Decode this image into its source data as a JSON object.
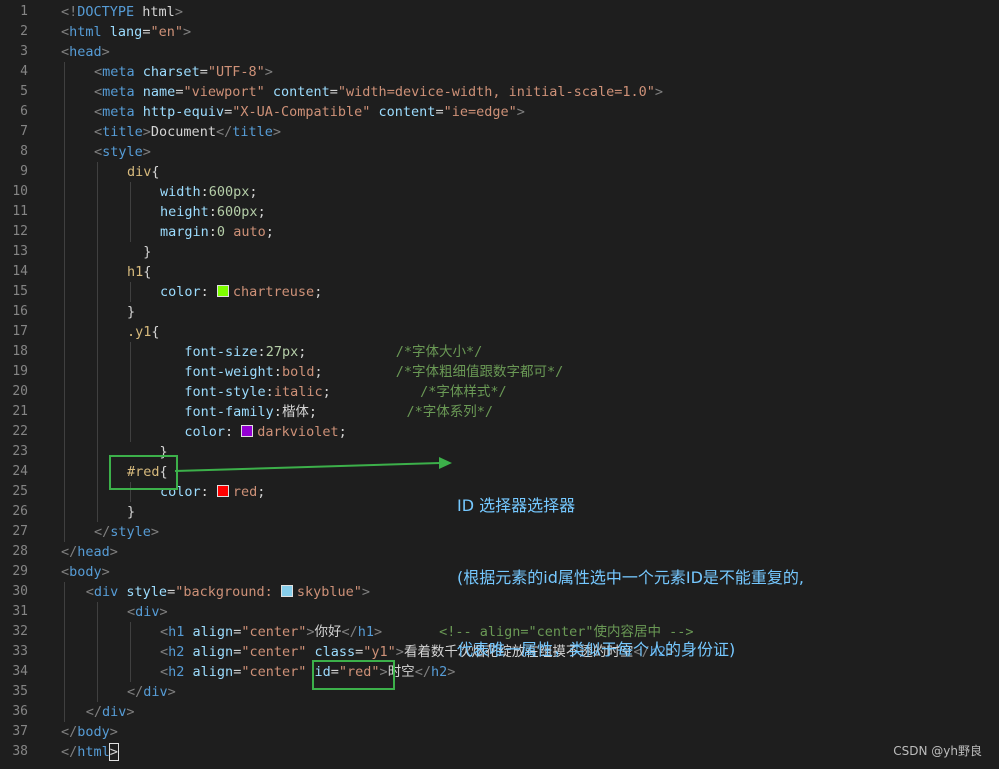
{
  "editor": {
    "lines": [
      {
        "n": "1",
        "i": 0,
        "guides": [],
        "t": [
          [
            "punct",
            "<!"
          ],
          [
            "tag",
            "DOCTYPE"
          ],
          [
            "text",
            " html"
          ],
          [
            "punct",
            ">"
          ]
        ]
      },
      {
        "n": "2",
        "i": 0,
        "guides": [],
        "t": [
          [
            "punct",
            "<"
          ],
          [
            "tag",
            "html"
          ],
          [
            "text",
            " "
          ],
          [
            "attr",
            "lang"
          ],
          [
            "text",
            "="
          ],
          [
            "str",
            "\"en\""
          ],
          [
            "punct",
            ">"
          ]
        ]
      },
      {
        "n": "3",
        "i": 0,
        "guides": [],
        "t": [
          [
            "punct",
            "<"
          ],
          [
            "tag",
            "head"
          ],
          [
            "punct",
            ">"
          ]
        ]
      },
      {
        "n": "4",
        "i": 1,
        "guides": [
          0
        ],
        "t": [
          [
            "punct",
            "<"
          ],
          [
            "tag",
            "meta"
          ],
          [
            "text",
            " "
          ],
          [
            "attr",
            "charset"
          ],
          [
            "text",
            "="
          ],
          [
            "str",
            "\"UTF-8\""
          ],
          [
            "punct",
            ">"
          ]
        ]
      },
      {
        "n": "5",
        "i": 1,
        "guides": [
          0
        ],
        "t": [
          [
            "punct",
            "<"
          ],
          [
            "tag",
            "meta"
          ],
          [
            "text",
            " "
          ],
          [
            "attr",
            "name"
          ],
          [
            "text",
            "="
          ],
          [
            "str",
            "\"viewport\""
          ],
          [
            "text",
            " "
          ],
          [
            "attr",
            "content"
          ],
          [
            "text",
            "="
          ],
          [
            "str",
            "\"width=device-width, initial-scale=1.0\""
          ],
          [
            "punct",
            ">"
          ]
        ]
      },
      {
        "n": "6",
        "i": 1,
        "guides": [
          0
        ],
        "t": [
          [
            "punct",
            "<"
          ],
          [
            "tag",
            "meta"
          ],
          [
            "text",
            " "
          ],
          [
            "attr",
            "http-equiv"
          ],
          [
            "text",
            "="
          ],
          [
            "str",
            "\"X-UA-Compatible\""
          ],
          [
            "text",
            " "
          ],
          [
            "attr",
            "content"
          ],
          [
            "text",
            "="
          ],
          [
            "str",
            "\"ie=edge\""
          ],
          [
            "punct",
            ">"
          ]
        ]
      },
      {
        "n": "7",
        "i": 1,
        "guides": [
          0
        ],
        "t": [
          [
            "punct",
            "<"
          ],
          [
            "tag",
            "title"
          ],
          [
            "punct",
            ">"
          ],
          [
            "text",
            "Document"
          ],
          [
            "punct",
            "</"
          ],
          [
            "tag",
            "title"
          ],
          [
            "punct",
            ">"
          ]
        ]
      },
      {
        "n": "8",
        "i": 1,
        "guides": [
          0
        ],
        "t": [
          [
            "punct",
            "<"
          ],
          [
            "tag",
            "style"
          ],
          [
            "punct",
            ">"
          ]
        ]
      },
      {
        "n": "9",
        "i": 2,
        "guides": [
          0,
          1
        ],
        "t": [
          [
            "sel",
            "div"
          ],
          [
            "text",
            "{"
          ]
        ]
      },
      {
        "n": "10",
        "i": 3,
        "guides": [
          0,
          1,
          2
        ],
        "t": [
          [
            "prop",
            "width"
          ],
          [
            "text",
            ":"
          ],
          [
            "num",
            "600px"
          ],
          [
            "text",
            ";"
          ]
        ]
      },
      {
        "n": "11",
        "i": 3,
        "guides": [
          0,
          1,
          2
        ],
        "t": [
          [
            "prop",
            "height"
          ],
          [
            "text",
            ":"
          ],
          [
            "num",
            "600px"
          ],
          [
            "text",
            ";"
          ]
        ]
      },
      {
        "n": "12",
        "i": 3,
        "guides": [
          0,
          1,
          2
        ],
        "t": [
          [
            "prop",
            "margin"
          ],
          [
            "text",
            ":"
          ],
          [
            "num",
            "0"
          ],
          [
            "text",
            " "
          ],
          [
            "str",
            "auto"
          ],
          [
            "text",
            ";"
          ]
        ]
      },
      {
        "n": "13",
        "i": 2,
        "guides": [
          0,
          1
        ],
        "t": [
          [
            "text",
            "  }"
          ]
        ]
      },
      {
        "n": "14",
        "i": 2,
        "guides": [
          0,
          1
        ],
        "t": [
          [
            "sel",
            "h1"
          ],
          [
            "text",
            "{"
          ]
        ]
      },
      {
        "n": "15",
        "i": 3,
        "guides": [
          0,
          1,
          2
        ],
        "t": [
          [
            "prop",
            "color"
          ],
          [
            "text",
            ": "
          ],
          [
            "swatch",
            "#7fff00"
          ],
          [
            "str",
            "chartreuse"
          ],
          [
            "text",
            ";"
          ]
        ]
      },
      {
        "n": "16",
        "i": 2,
        "guides": [
          0,
          1
        ],
        "t": [
          [
            "text",
            "}"
          ]
        ]
      },
      {
        "n": "17",
        "i": 2,
        "guides": [
          0,
          1
        ],
        "t": [
          [
            "sel",
            ".y1"
          ],
          [
            "text",
            "{"
          ]
        ]
      },
      {
        "n": "18",
        "i": 3,
        "guides": [
          0,
          1,
          2
        ],
        "t": [
          [
            "text",
            "   "
          ],
          [
            "prop",
            "font-size"
          ],
          [
            "text",
            ":"
          ],
          [
            "num",
            "27px"
          ],
          [
            "text",
            ";           "
          ],
          [
            "comment",
            "/*字体大小*/"
          ]
        ]
      },
      {
        "n": "19",
        "i": 3,
        "guides": [
          0,
          1,
          2
        ],
        "t": [
          [
            "text",
            "   "
          ],
          [
            "prop",
            "font-weight"
          ],
          [
            "text",
            ":"
          ],
          [
            "str",
            "bold"
          ],
          [
            "text",
            ";         "
          ],
          [
            "comment",
            "/*字体粗细值跟数字都可*/"
          ]
        ]
      },
      {
        "n": "20",
        "i": 3,
        "guides": [
          0,
          1,
          2
        ],
        "t": [
          [
            "text",
            "   "
          ],
          [
            "prop",
            "font-style"
          ],
          [
            "text",
            ":"
          ],
          [
            "str",
            "italic"
          ],
          [
            "text",
            ";           "
          ],
          [
            "comment",
            "/*字体样式*/"
          ]
        ]
      },
      {
        "n": "21",
        "i": 3,
        "guides": [
          0,
          1,
          2
        ],
        "t": [
          [
            "text",
            "   "
          ],
          [
            "prop",
            "font-family"
          ],
          [
            "text",
            ":"
          ],
          [
            "text",
            "楷体;"
          ],
          [
            "text",
            "           "
          ],
          [
            "comment",
            "/*字体系列*/"
          ]
        ]
      },
      {
        "n": "22",
        "i": 3,
        "guides": [
          0,
          1,
          2
        ],
        "t": [
          [
            "text",
            "   "
          ],
          [
            "prop",
            "color"
          ],
          [
            "text",
            ": "
          ],
          [
            "swatch",
            "#9400d3"
          ],
          [
            "str",
            "darkviolet"
          ],
          [
            "text",
            ";"
          ]
        ]
      },
      {
        "n": "23",
        "i": 2,
        "guides": [
          0,
          1
        ],
        "t": [
          [
            "text",
            "    }"
          ]
        ]
      },
      {
        "n": "24",
        "i": 2,
        "guides": [
          0,
          1
        ],
        "t": [
          [
            "sel",
            "#red"
          ],
          [
            "text",
            "{"
          ]
        ]
      },
      {
        "n": "25",
        "i": 3,
        "guides": [
          0,
          1,
          2
        ],
        "t": [
          [
            "prop",
            "color"
          ],
          [
            "text",
            ": "
          ],
          [
            "swatch",
            "#ff0000"
          ],
          [
            "str",
            "red"
          ],
          [
            "text",
            ";"
          ]
        ]
      },
      {
        "n": "26",
        "i": 2,
        "guides": [
          0,
          1
        ],
        "t": [
          [
            "text",
            "}"
          ]
        ]
      },
      {
        "n": "27",
        "i": 1,
        "guides": [
          0
        ],
        "t": [
          [
            "punct",
            "</"
          ],
          [
            "tag",
            "style"
          ],
          [
            "punct",
            ">"
          ]
        ]
      },
      {
        "n": "28",
        "i": 0,
        "guides": [],
        "t": [
          [
            "punct",
            "</"
          ],
          [
            "tag",
            "head"
          ],
          [
            "punct",
            ">"
          ]
        ]
      },
      {
        "n": "29",
        "i": 0,
        "guides": [],
        "t": [
          [
            "punct",
            "<"
          ],
          [
            "tag",
            "body"
          ],
          [
            "punct",
            ">"
          ]
        ]
      },
      {
        "n": "30",
        "i": 0.75,
        "guides": [
          0
        ],
        "t": [
          [
            "punct",
            "<"
          ],
          [
            "tag",
            "div"
          ],
          [
            "text",
            " "
          ],
          [
            "attr",
            "style"
          ],
          [
            "text",
            "="
          ],
          [
            "str",
            "\"background: "
          ],
          [
            "swatch",
            "#87ceeb"
          ],
          [
            "str",
            "skyblue\""
          ],
          [
            "punct",
            ">"
          ]
        ]
      },
      {
        "n": "31",
        "i": 2,
        "guides": [
          0,
          1
        ],
        "t": [
          [
            "punct",
            "<"
          ],
          [
            "tag",
            "div"
          ],
          [
            "punct",
            ">"
          ]
        ]
      },
      {
        "n": "32",
        "i": 3,
        "guides": [
          0,
          1,
          2
        ],
        "t": [
          [
            "punct",
            "<"
          ],
          [
            "tag",
            "h1"
          ],
          [
            "text",
            " "
          ],
          [
            "attr",
            "align"
          ],
          [
            "text",
            "="
          ],
          [
            "str",
            "\"center\""
          ],
          [
            "punct",
            ">"
          ],
          [
            "text",
            "你好"
          ],
          [
            "punct",
            "</"
          ],
          [
            "tag",
            "h1"
          ],
          [
            "punct",
            ">"
          ],
          [
            "text",
            "       "
          ],
          [
            "comment",
            "<!-- align=\"center\"使内容居中 -->"
          ]
        ]
      },
      {
        "n": "33",
        "i": 3,
        "guides": [
          0,
          1,
          2
        ],
        "t": [
          [
            "punct",
            "<"
          ],
          [
            "tag",
            "h2"
          ],
          [
            "text",
            " "
          ],
          [
            "attr",
            "align"
          ],
          [
            "text",
            "="
          ],
          [
            "str",
            "\"center\""
          ],
          [
            "text",
            " "
          ],
          [
            "attr",
            "class"
          ],
          [
            "text",
            "="
          ],
          [
            "str",
            "\"y1\""
          ],
          [
            "punct",
            ">"
          ],
          [
            "text",
            "看着数千次烟花绽放在组摸不透的时空"
          ],
          [
            "punct",
            "</"
          ],
          [
            "tag",
            "h2"
          ],
          [
            "punct",
            ">"
          ]
        ]
      },
      {
        "n": "34",
        "i": 3,
        "guides": [
          0,
          1,
          2
        ],
        "t": [
          [
            "punct",
            "<"
          ],
          [
            "tag",
            "h2"
          ],
          [
            "text",
            " "
          ],
          [
            "attr",
            "align"
          ],
          [
            "text",
            "="
          ],
          [
            "str",
            "\"center\""
          ],
          [
            "text",
            " "
          ],
          [
            "attr",
            "id"
          ],
          [
            "text",
            "="
          ],
          [
            "str",
            "\"red\""
          ],
          [
            "punct",
            ">"
          ],
          [
            "text",
            "时空"
          ],
          [
            "punct",
            "</"
          ],
          [
            "tag",
            "h2"
          ],
          [
            "punct",
            ">"
          ]
        ]
      },
      {
        "n": "35",
        "i": 2,
        "guides": [
          0,
          1
        ],
        "t": [
          [
            "punct",
            "</"
          ],
          [
            "tag",
            "div"
          ],
          [
            "punct",
            ">"
          ]
        ]
      },
      {
        "n": "36",
        "i": 0.75,
        "guides": [
          0
        ],
        "t": [
          [
            "punct",
            "</"
          ],
          [
            "tag",
            "div"
          ],
          [
            "punct",
            ">"
          ]
        ]
      },
      {
        "n": "37",
        "i": 0,
        "guides": [],
        "t": [
          [
            "punct",
            "</"
          ],
          [
            "tag",
            "body"
          ],
          [
            "punct",
            ">"
          ]
        ]
      },
      {
        "n": "38",
        "i": 0,
        "guides": [],
        "t": [
          [
            "punct",
            "</"
          ],
          [
            "tag",
            "html"
          ],
          [
            "cursor",
            ">"
          ]
        ]
      }
    ]
  },
  "annotation": {
    "title": "ID 选择器选择器",
    "line2": "(根据元素的id属性选中一个元素ID是不能重复的,",
    "line3": "代表唯一属性，类似于每个人的身份证)"
  },
  "watermark": "CSDN @yh野良",
  "colors": {
    "background": "#1e1e1e",
    "highlight_box": "#3cb04a",
    "annotation_text": "#75c8ff"
  }
}
